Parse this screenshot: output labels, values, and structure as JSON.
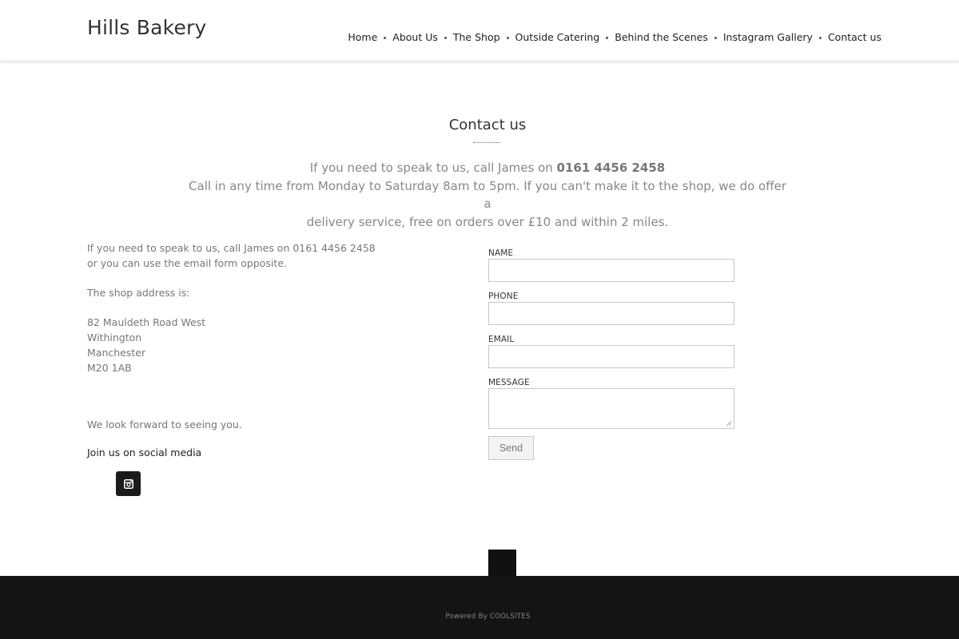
{
  "site": {
    "title": "Hills Bakery"
  },
  "nav": {
    "items": [
      "Home",
      "About Us",
      "The Shop",
      "Outside Catering",
      "Behind the Scenes",
      "Instagram Gallery",
      "Contact us"
    ]
  },
  "contact": {
    "heading": "Contact us",
    "intro_line1_prefix": "If you need to speak to us, call James on ",
    "intro_phone": "0161 4456 2458",
    "intro_line2": "Call in any time from Monday to Saturday 8am to 5pm. If you can't make it to the shop, we do offer a",
    "intro_line3": "delivery service, free on orders over £10 and within 2 miles."
  },
  "left": {
    "line1": "If you need to speak to us, call James on 0161 4456 2458",
    "line2": "or you can use the email form opposite.",
    "address_intro": "The shop address is:",
    "address": [
      "82 Mauldeth Road West",
      "Withington",
      "Manchester",
      "M20 1AB"
    ],
    "closing": "We look forward to seeing you.",
    "social_label": "Join us on social media",
    "social_icon": "instagram-icon"
  },
  "form": {
    "name_label": "NAME",
    "phone_label": "PHONE",
    "email_label": "EMAIL",
    "message_label": "MESSAGE",
    "name_value": "",
    "phone_value": "",
    "email_value": "",
    "message_value": "",
    "send_label": "Send"
  },
  "footer": {
    "powered_by": "Powered By COOLSITES"
  },
  "colors": {
    "footer_bg": "#141414",
    "text_muted": "#888888",
    "heading": "#333333"
  }
}
